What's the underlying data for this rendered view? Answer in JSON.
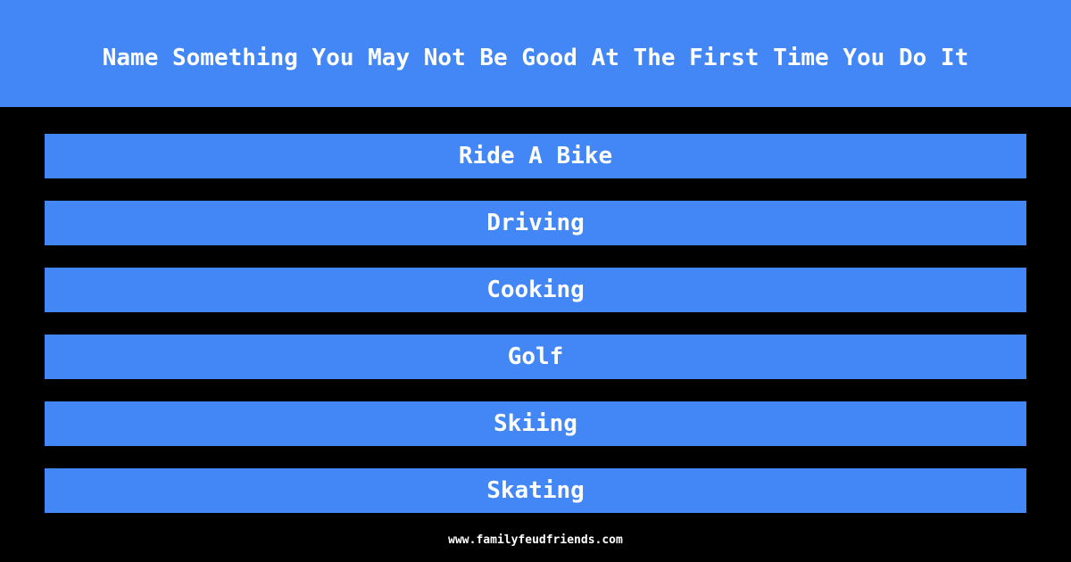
{
  "header": {
    "question": "Name Something You May Not Be Good At The First Time You Do It"
  },
  "answers": [
    {
      "label": "Ride A Bike"
    },
    {
      "label": "Driving"
    },
    {
      "label": "Cooking"
    },
    {
      "label": "Golf"
    },
    {
      "label": "Skiing"
    },
    {
      "label": "Skating"
    }
  ],
  "footer": {
    "site": "www.familyfeudfriends.com"
  },
  "colors": {
    "accent": "#4287f5",
    "background": "#000000",
    "text": "#ffffff"
  }
}
